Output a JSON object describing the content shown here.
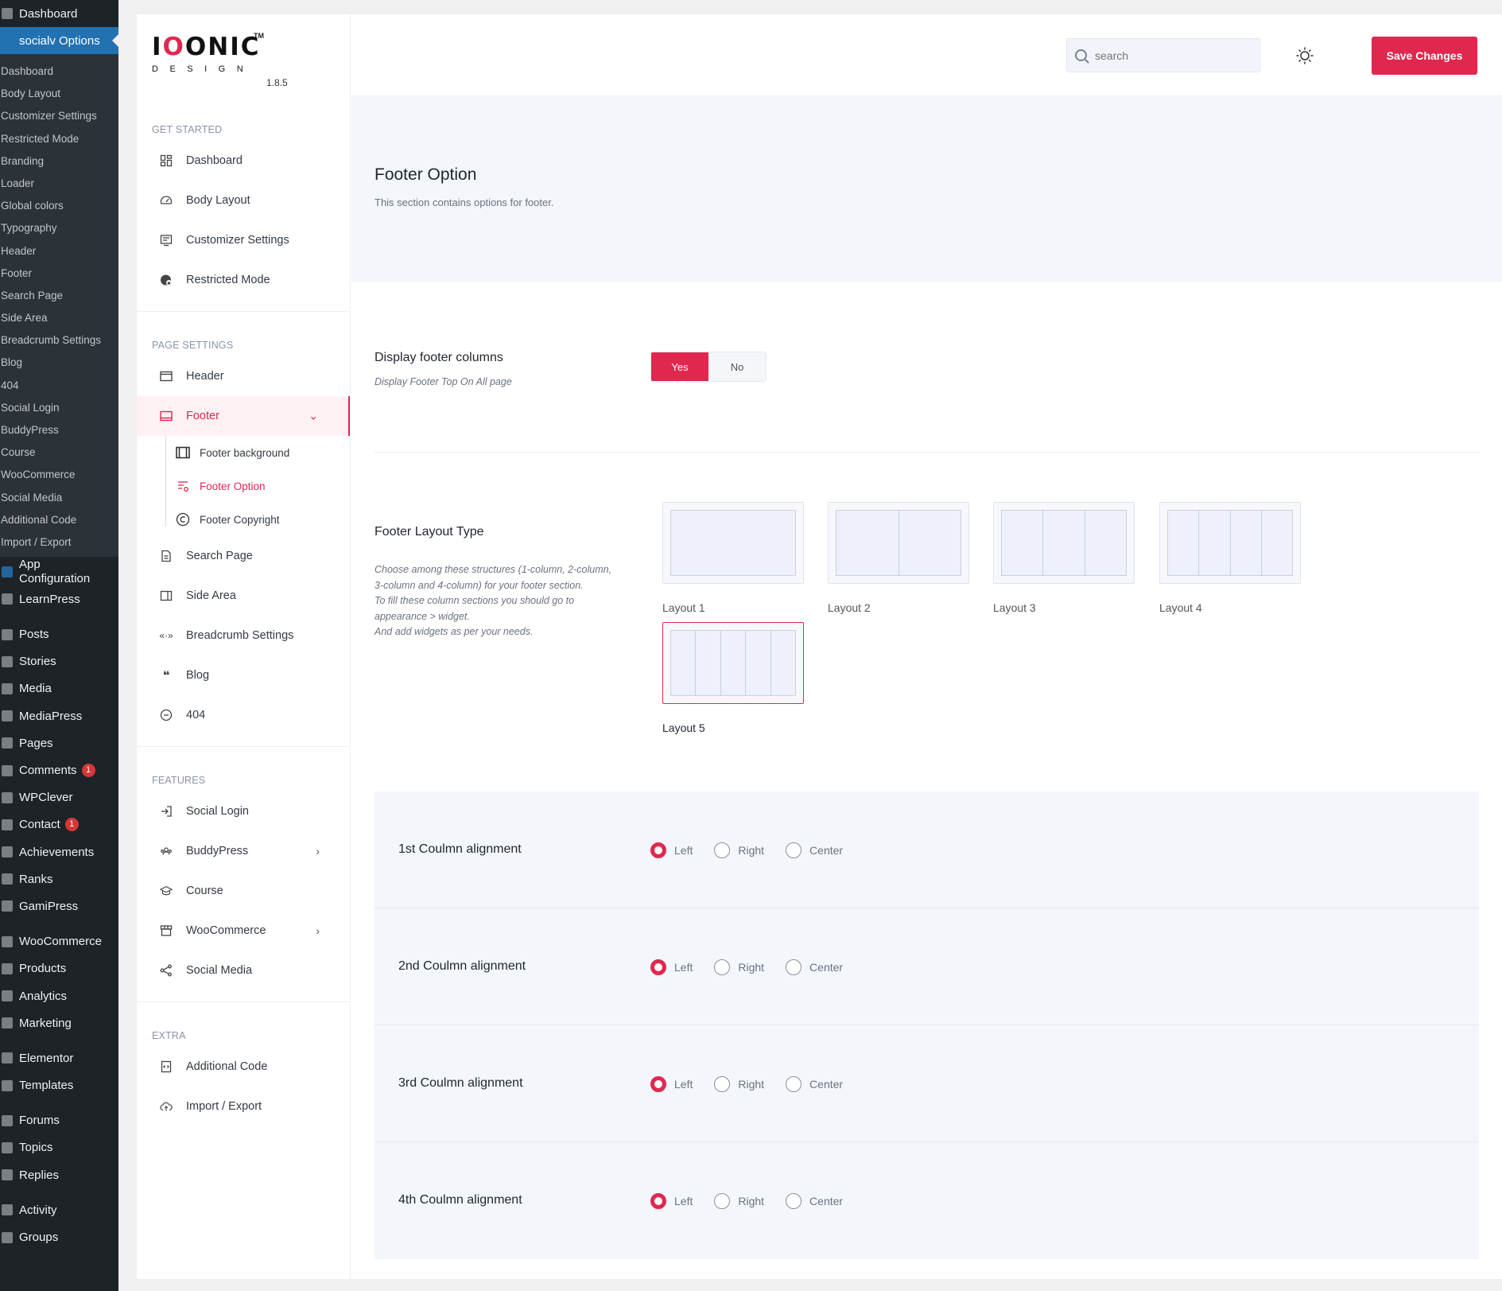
{
  "wp": {
    "top": [
      {
        "label": "Dashboard",
        "icon": "dashboard-icon"
      },
      {
        "label": "socialv Options",
        "icon": "options-icon",
        "active": true
      }
    ],
    "submenu": [
      "Dashboard",
      "Body Layout",
      "Customizer Settings",
      "Restricted Mode",
      "Branding",
      "Loader",
      "Global colors",
      "Typography",
      "Header",
      "Footer",
      "Search Page",
      "Side Area",
      "Breadcrumb Settings",
      "Blog",
      "404",
      "Social Login",
      "BuddyPress",
      "Course",
      "WooCommerce",
      "Social Media",
      "Additional Code",
      "Import / Export"
    ],
    "menu": {
      "app_config": "App Configuration",
      "learnpress": "LearnPress",
      "posts": "Posts",
      "stories": "Stories",
      "media": "Media",
      "mediapress": "MediaPress",
      "pages": "Pages",
      "comments": "Comments",
      "comments_badge": "1",
      "wpclever": "WPClever",
      "contact": "Contact",
      "contact_badge": "1",
      "achievements": "Achievements",
      "ranks": "Ranks",
      "gamipress": "GamiPress",
      "woocommerce": "WooCommerce",
      "products": "Products",
      "analytics": "Analytics",
      "marketing": "Marketing",
      "elementor": "Elementor",
      "templates": "Templates",
      "forums": "Forums",
      "topics": "Topics",
      "replies": "Replies",
      "activity": "Activity",
      "groups": "Groups"
    }
  },
  "brand": {
    "logo_main_a": "I",
    "logo_main_b": "O",
    "logo_main_c": "ONIC",
    "tm": "TM",
    "logo_sub": "DESIGN",
    "version": "1.8.5"
  },
  "topbar": {
    "search_placeholder": "search",
    "save_label": "Save Changes"
  },
  "nav": {
    "get_started": {
      "heading": "GET STARTED",
      "items": [
        "Dashboard",
        "Body Layout",
        "Customizer Settings",
        "Restricted Mode"
      ]
    },
    "page_settings": {
      "heading": "PAGE SETTINGS",
      "header": "Header",
      "footer": "Footer",
      "footer_sub": [
        "Footer background",
        "Footer Option",
        "Footer Copyright"
      ],
      "rest": [
        "Search Page",
        "Side Area",
        "Breadcrumb Settings",
        "Blog",
        "404"
      ]
    },
    "features": {
      "heading": "FEATURES",
      "items": [
        "Social Login",
        "BuddyPress",
        "Course",
        "WooCommerce",
        "Social Media"
      ]
    },
    "extra": {
      "heading": "EXTRA",
      "items": [
        "Additional Code",
        "Import / Export"
      ]
    }
  },
  "content": {
    "title": "Footer Option",
    "subtitle": "This section contains options for footer.",
    "display": {
      "title": "Display footer columns",
      "desc": "Display Footer Top On All page",
      "yes": "Yes",
      "no": "No",
      "selected": "Yes"
    },
    "layout": {
      "title": "Footer Layout Type",
      "desc_1": "Choose among these structures (1-column, 2-column, 3-column and 4-column) for your footer section.",
      "desc_2": "To fill these column sections you should go to appearance > widget.",
      "desc_3": "And add widgets as per your needs.",
      "options": [
        "Layout 1",
        "Layout 2",
        "Layout 3",
        "Layout 4",
        "Layout 5"
      ],
      "selected": "Layout 5"
    },
    "alignments": [
      {
        "title": "1st Coulmn alignment",
        "selected": "Left"
      },
      {
        "title": "2nd Coulmn alignment",
        "selected": "Left"
      },
      {
        "title": "3rd Coulmn alignment",
        "selected": "Left"
      },
      {
        "title": "4th Coulmn alignment",
        "selected": "Left"
      }
    ],
    "align_options": [
      "Left",
      "Right",
      "Center"
    ]
  },
  "colors": {
    "accent": "#e0284f",
    "wp_sidebar": "#1d2327",
    "wp_active": "#2271b1",
    "hero_bg": "#f3f6fb"
  }
}
